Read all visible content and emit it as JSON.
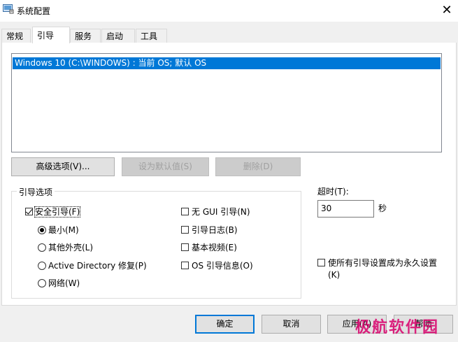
{
  "window": {
    "title": "系统配置",
    "close_glyph": "✕"
  },
  "tabs": [
    {
      "label": "常规"
    },
    {
      "label": "引导"
    },
    {
      "label": "服务"
    },
    {
      "label": "启动"
    },
    {
      "label": "工具"
    }
  ],
  "os_list": {
    "items": [
      "Windows 10 (C:\\WINDOWS) : 当前 OS; 默认 OS"
    ]
  },
  "os_buttons": {
    "advanced": "高级选项(V)...",
    "set_default": "设为默认值(S)",
    "delete": "删除(D)"
  },
  "boot_options": {
    "label": "引导选项",
    "safe_boot": {
      "label": "安全引导(F)",
      "checked": true
    },
    "minimal": {
      "label": "最小(M)",
      "selected": true
    },
    "alternate_shell": {
      "label": "其他外壳(L)",
      "selected": false
    },
    "active_directory": {
      "label": "Active Directory 修复(P)",
      "selected": false
    },
    "network": {
      "label": "网络(W)",
      "selected": false
    },
    "no_gui": {
      "label": "无 GUI 引导(N)",
      "checked": false
    },
    "boot_log": {
      "label": "引导日志(B)",
      "checked": false
    },
    "base_video": {
      "label": "基本视频(E)",
      "checked": false
    },
    "os_info": {
      "label": "OS 引导信息(O)",
      "checked": false
    }
  },
  "timeout": {
    "label": "超时(T):",
    "value": "30",
    "unit": "秒"
  },
  "permanent": {
    "label_line1": "使所有引导设置成为永久设置",
    "label_line2": "(K)",
    "checked": false
  },
  "footer": {
    "ok": "确定",
    "cancel": "取消",
    "apply": "应用(A)",
    "help": "帮助"
  },
  "watermark": "极航软件园",
  "colors": {
    "selection": "#0078d7",
    "accent_border": "#0078d7",
    "watermark": "#d9006c"
  }
}
